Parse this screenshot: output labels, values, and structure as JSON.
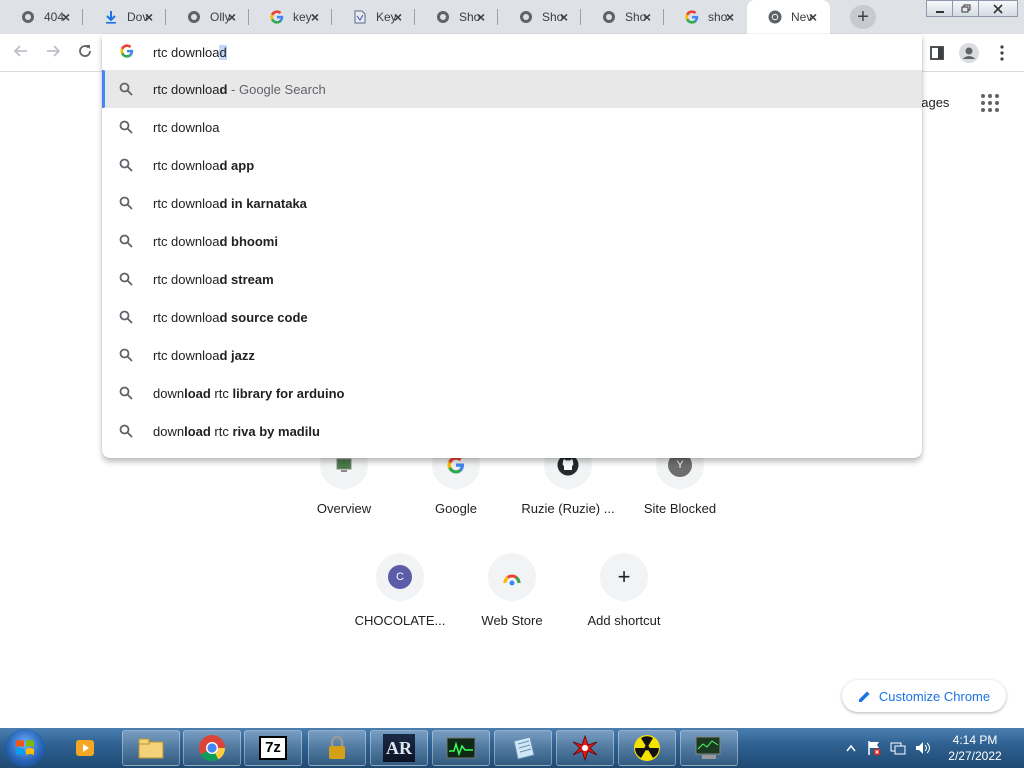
{
  "tabs": [
    {
      "title": "404",
      "icon": "globe-icon"
    },
    {
      "title": "Dov",
      "icon": "download-icon"
    },
    {
      "title": "Olly",
      "icon": "globe-icon"
    },
    {
      "title": "key",
      "icon": "google-icon"
    },
    {
      "title": "Key",
      "icon": "document-icon"
    },
    {
      "title": "Sho",
      "icon": "globe-icon"
    },
    {
      "title": "Sho",
      "icon": "globe-icon"
    },
    {
      "title": "Sho",
      "icon": "globe-icon"
    },
    {
      "title": "sho",
      "icon": "google-icon"
    },
    {
      "title": "Nev",
      "icon": "chrome-icon",
      "active": true
    }
  ],
  "omnibox": {
    "typed": "rtc downloa",
    "selected_completion": "d"
  },
  "suggestions": [
    {
      "plain": "rtc downloa",
      "bold": "d",
      "suffix": " - Google Search"
    },
    {
      "plain": "rtc downloa",
      "bold": "",
      "suffix": ""
    },
    {
      "plain": "rtc downloa",
      "bold": "d app",
      "suffix": ""
    },
    {
      "plain": "rtc downloa",
      "bold": "d in karnataka",
      "suffix": ""
    },
    {
      "plain": "rtc downloa",
      "bold": "d bhoomi",
      "suffix": ""
    },
    {
      "plain": "rtc downloa",
      "bold": "d stream",
      "suffix": ""
    },
    {
      "plain": "rtc downloa",
      "bold": "d source code",
      "suffix": ""
    },
    {
      "plain": "rtc downloa",
      "bold": "d jazz",
      "suffix": ""
    },
    {
      "parts": [
        [
          "down",
          false
        ],
        [
          "load",
          true
        ],
        [
          " rtc ",
          false
        ],
        [
          "library for arduino",
          true
        ]
      ]
    },
    {
      "parts": [
        [
          "down",
          false
        ],
        [
          "load",
          true
        ],
        [
          " rtc ",
          false
        ],
        [
          "riva by madilu",
          true
        ]
      ]
    }
  ],
  "ntp": {
    "images_link": "nages",
    "shortcuts": [
      {
        "label": "Overview",
        "letter": ""
      },
      {
        "label": "Google",
        "letter": ""
      },
      {
        "label": "Ruzie (Ruzie) ...",
        "letter": ""
      },
      {
        "label": "Site Blocked",
        "letter": "Y"
      },
      {
        "label": "CHOCOLATE...",
        "letter": "C"
      },
      {
        "label": "Web Store",
        "letter": ""
      },
      {
        "label": "Add shortcut",
        "letter": "+"
      }
    ],
    "customize_label": "Customize Chrome"
  },
  "clock": {
    "time": "4:14 PM",
    "date": "2/27/2022"
  },
  "colors": {
    "accent": "#1a73e8",
    "tab_strip": "#dee1e6",
    "selected_row": "#e8e8e9",
    "taskbar": "#2d5f8f"
  }
}
